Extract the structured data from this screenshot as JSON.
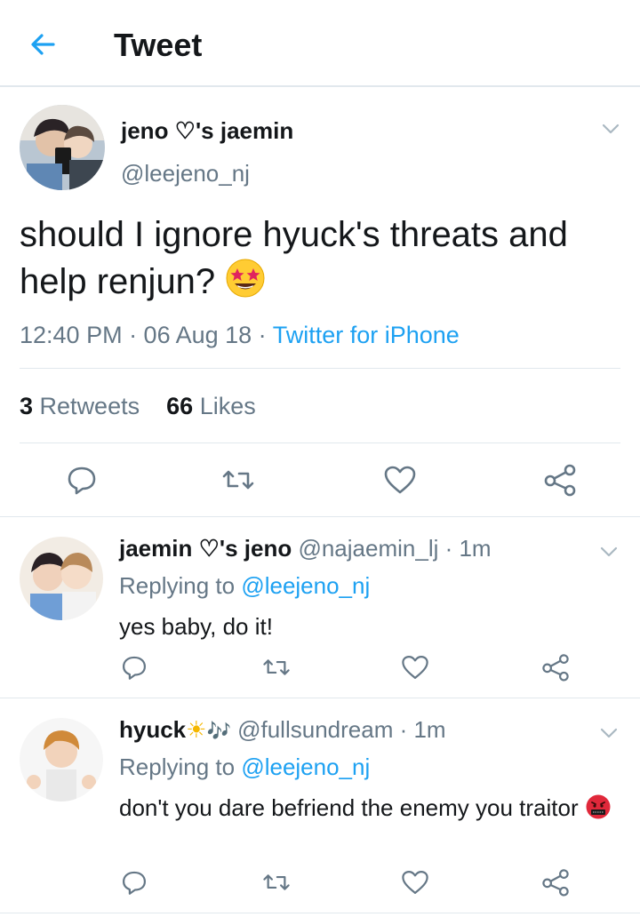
{
  "topbar": {
    "title": "Tweet",
    "back_icon": "arrow-left-icon"
  },
  "colors": {
    "accent": "#1da1f2",
    "muted": "#657786",
    "divider": "#e1e8ed",
    "text": "#14171a"
  },
  "tweet": {
    "author_name": "jeno ♡'s jaemin",
    "author_handle": "@leejeno_nj",
    "text": "should I ignore hyuck's threats and help renjun?",
    "emoji_icon": "star-struck-emoji-icon",
    "time": "12:40 PM · 06 Aug 18 · ",
    "source": "Twitter for iPhone",
    "retweets_count": "3",
    "retweets_label": "Retweets",
    "likes_count": "66",
    "likes_label": "Likes"
  },
  "replies": [
    {
      "name": "jaemin ♡'s jeno",
      "handle": "@najaemin_lj · 1m",
      "replying_prefix": "Replying to ",
      "replying_to": "@leejeno_nj",
      "text": "yes baby, do it!"
    },
    {
      "name": "hyuck",
      "name_emoji": "☀",
      "name_music": "🎶",
      "handle": "@fullsundream · 1m",
      "replying_prefix": "Replying to ",
      "replying_to": "@leejeno_nj",
      "text": "don't you dare befriend the enemy you traitor",
      "emoji_icon": "cursing-face-emoji-icon"
    }
  ]
}
